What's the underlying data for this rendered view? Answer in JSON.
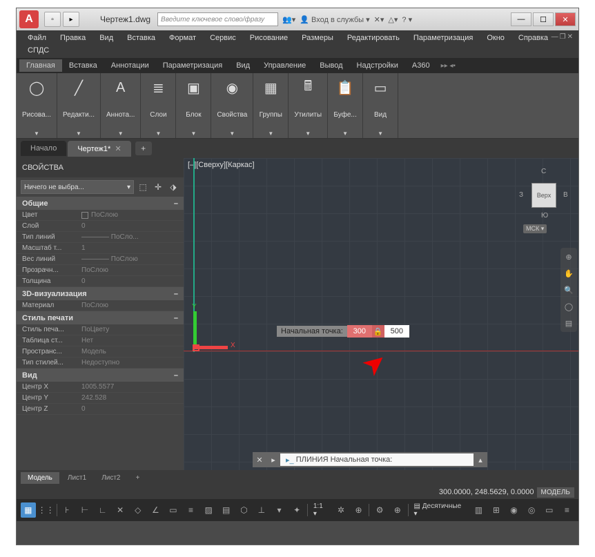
{
  "title": "Чертеж1.dwg",
  "search_placeholder": "Введите ключевое слово/фразу",
  "login_label": "Вход в службы",
  "menus": [
    "Файл",
    "Правка",
    "Вид",
    "Вставка",
    "Формат",
    "Сервис",
    "Рисование",
    "Размеры",
    "Редактировать",
    "Параметризация",
    "Окно",
    "Справка",
    "СПДС"
  ],
  "ribbon_tabs": [
    "Главная",
    "Вставка",
    "Аннотации",
    "Параметризация",
    "Вид",
    "Управление",
    "Вывод",
    "Надстройки",
    "A360"
  ],
  "ribbon_panels": [
    "Рисова...",
    "Редакти...",
    "Аннота...",
    "Слои",
    "Блок",
    "Свойства",
    "Группы",
    "Утилиты",
    "Буфе...",
    "Вид"
  ],
  "doc_tabs": {
    "start": "Начало",
    "active": "Чертеж1*"
  },
  "props": {
    "title": "СВОЙСТВА",
    "selection": "Ничего не выбра...",
    "groups": {
      "general": {
        "title": "Общие",
        "rows": [
          {
            "label": "Цвет",
            "value": "ПоСлою",
            "swatch": true
          },
          {
            "label": "Слой",
            "value": "0"
          },
          {
            "label": "Тип линий",
            "value": "———— ПоСло..."
          },
          {
            "label": "Масштаб т...",
            "value": "1"
          },
          {
            "label": "Вес линий",
            "value": "———— ПоСлою"
          },
          {
            "label": "Прозрачн...",
            "value": "ПоСлою"
          },
          {
            "label": "Толщина",
            "value": "0"
          }
        ]
      },
      "viz": {
        "title": "3D-визуализация",
        "rows": [
          {
            "label": "Материал",
            "value": "ПоСлою"
          }
        ]
      },
      "print": {
        "title": "Стиль печати",
        "rows": [
          {
            "label": "Стиль печа...",
            "value": "ПоЦвету"
          },
          {
            "label": "Таблица ст...",
            "value": "Нет"
          },
          {
            "label": "Пространс...",
            "value": "Модель"
          },
          {
            "label": "Тип стилей...",
            "value": "Недоступно"
          }
        ]
      },
      "view": {
        "title": "Вид",
        "rows": [
          {
            "label": "Центр X",
            "value": "1005.5577"
          },
          {
            "label": "Центр Y",
            "value": "242.528"
          },
          {
            "label": "Центр Z",
            "value": "0"
          }
        ]
      }
    }
  },
  "view_label": "[–][Сверху][Каркас]",
  "viewcube": {
    "face": "Верх",
    "n": "С",
    "s": "Ю",
    "e": "В",
    "w": "З",
    "ucs": "МСК"
  },
  "dynamic_input": {
    "label": "Начальная точка:",
    "x": "300",
    "y": "500"
  },
  "cmdline": "ПЛИНИЯ Начальная точка:",
  "layout_tabs": [
    "Модель",
    "Лист1",
    "Лист2"
  ],
  "coords": "300.0000, 248.5629, 0.0000",
  "model_badge": "МОДЕЛЬ",
  "bottom_scale": "1:1",
  "bottom_units": "Десятичные"
}
